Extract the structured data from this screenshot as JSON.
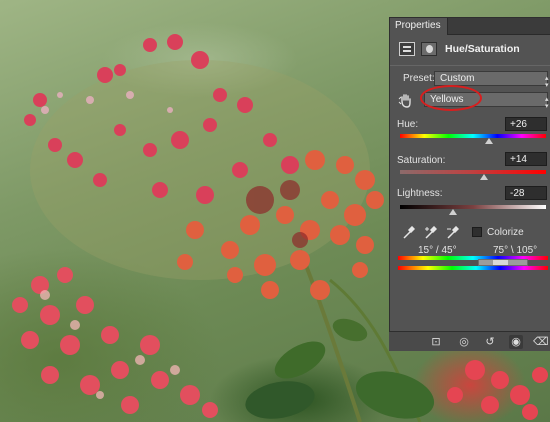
{
  "panel": {
    "tab_label": "Properties",
    "title": "Hue/Saturation",
    "preset_label": "Preset:",
    "preset_value": "Custom",
    "channel_value": "Yellows",
    "hue_label": "Hue:",
    "hue_value": "+26",
    "saturation_label": "Saturation:",
    "saturation_value": "+14",
    "lightness_label": "Lightness:",
    "lightness_value": "-28",
    "colorize_label": "Colorize",
    "colorize_checked": false,
    "range_left": "15° / 45°",
    "range_right": "75° \\ 105°"
  },
  "sliders": {
    "hue_fraction": 0.57,
    "saturation_fraction": 0.57,
    "lightness_fraction": 0.36
  },
  "icons": {
    "adjustment": "hue-saturation-icon",
    "mask": "layer-mask-icon",
    "targeted_adjustment": "hand-adjust-icon",
    "eyedropper": "eyedropper-icon",
    "eyedropper_plus": "eyedropper-plus-icon",
    "eyedropper_minus": "eyedropper-minus-icon",
    "clip": "clip-to-layer-icon",
    "view_previous": "view-previous-icon",
    "reset": "reset-icon",
    "visibility": "eye-icon",
    "delete": "trash-icon"
  },
  "colors": {
    "panel_bg": "#535353",
    "highlight_ring": "#d81e1e"
  }
}
